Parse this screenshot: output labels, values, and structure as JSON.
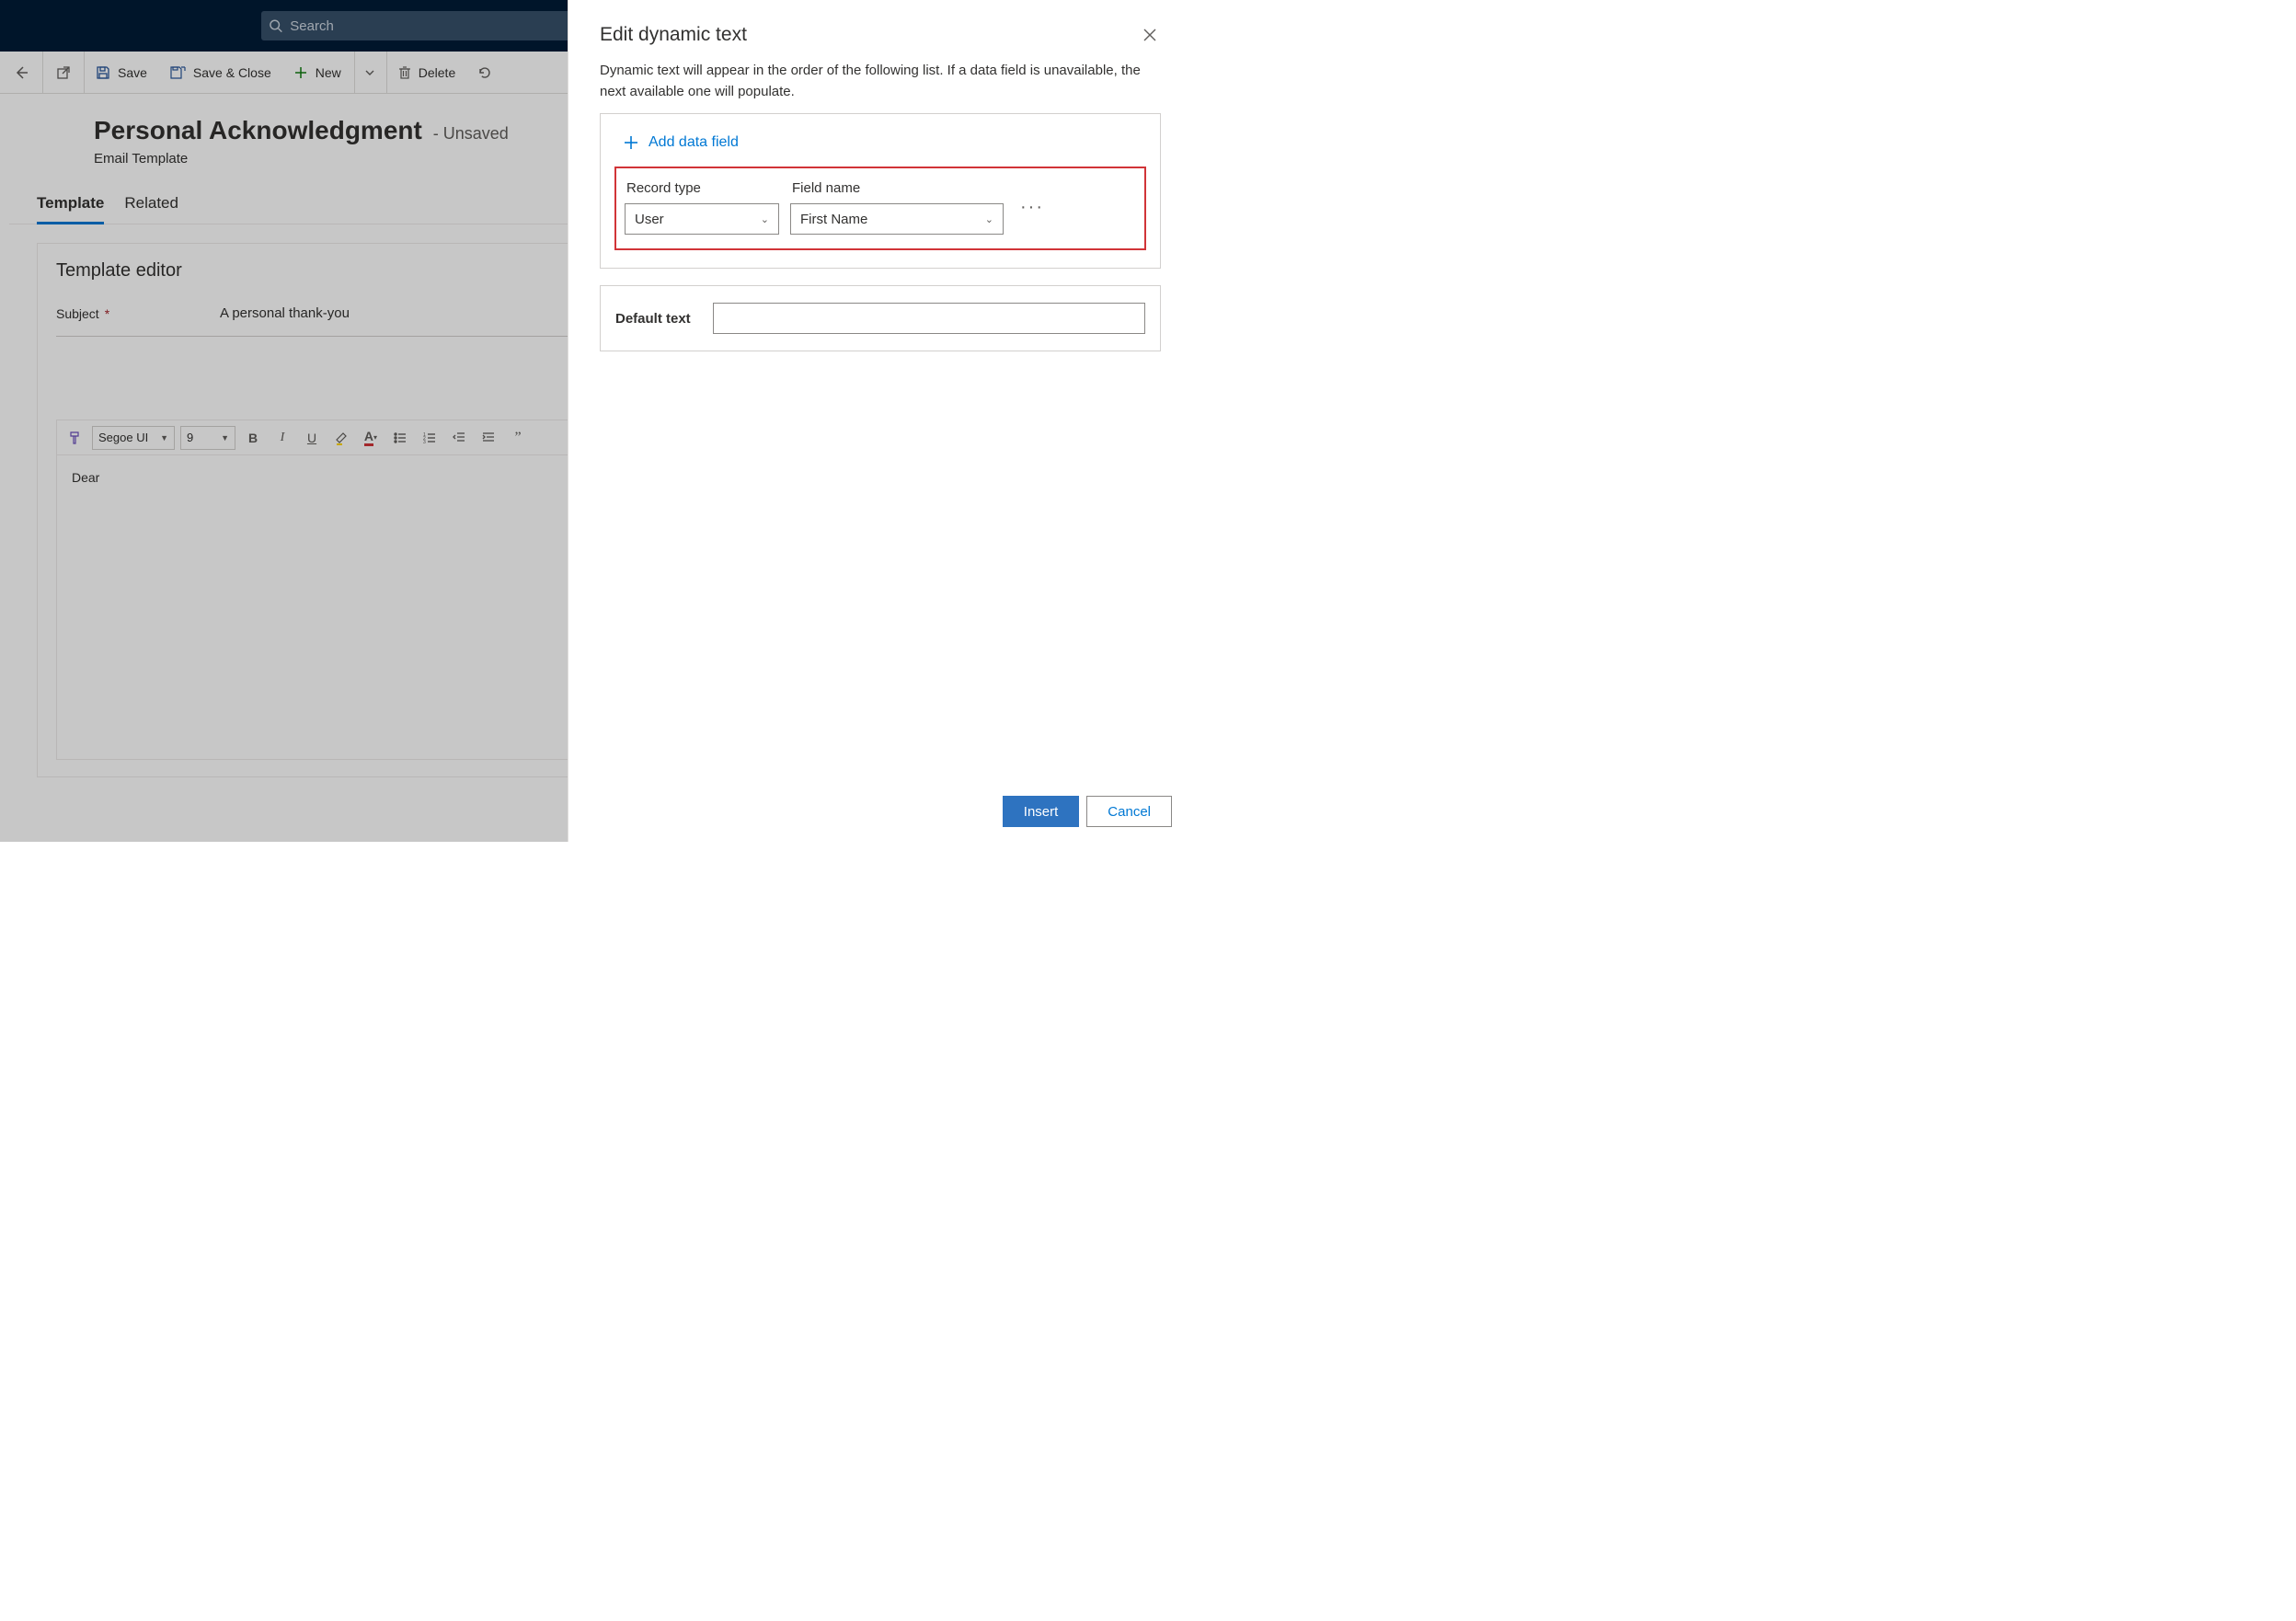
{
  "search": {
    "placeholder": "Search"
  },
  "commands": {
    "save": "Save",
    "save_close": "Save & Close",
    "new": "New",
    "delete": "Delete"
  },
  "page": {
    "title": "Personal Acknowledgment",
    "status": "- Unsaved",
    "subtitle": "Email Template"
  },
  "tabs": {
    "template": "Template",
    "related": "Related"
  },
  "editor": {
    "title": "Template editor",
    "subject_label": "Subject",
    "subject_value": "A personal thank-you",
    "font_name": "Segoe UI",
    "font_size": "9",
    "body_text": "Dear"
  },
  "panel": {
    "title": "Edit dynamic text",
    "description": "Dynamic text will appear in the order of the following list. If a data field is unavailable, the next available one will populate.",
    "add_label": "Add data field",
    "record_type_label": "Record type",
    "record_type_value": "User",
    "field_name_label": "Field name",
    "field_name_value": "First Name",
    "default_label": "Default text",
    "default_value": "",
    "insert": "Insert",
    "cancel": "Cancel"
  }
}
